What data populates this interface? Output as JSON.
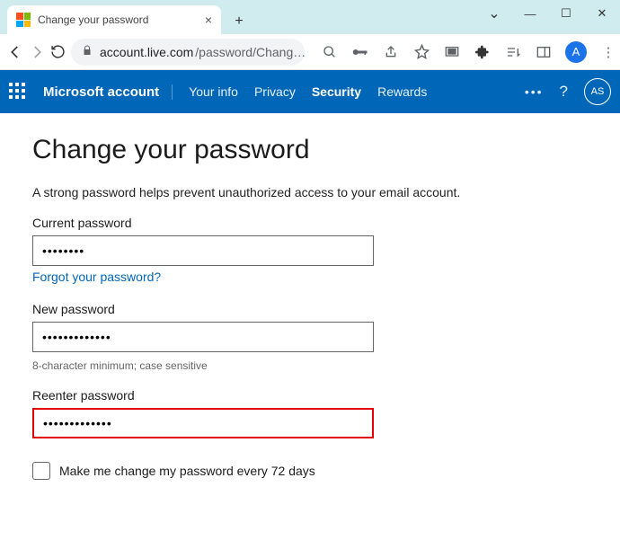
{
  "browser": {
    "tab_title": "Change your password",
    "url_display_host": "account.live.com",
    "url_display_path": "/password/Chang…",
    "profile_initial": "A"
  },
  "nav": {
    "brand": "Microsoft account",
    "items": [
      {
        "label": "Your info",
        "active": false
      },
      {
        "label": "Privacy",
        "active": false
      },
      {
        "label": "Security",
        "active": true
      },
      {
        "label": "Rewards",
        "active": false
      }
    ],
    "avatar_initials": "AS"
  },
  "page": {
    "heading": "Change your password",
    "description": "A strong password helps prevent unauthorized access to your email account.",
    "current_password_label": "Current password",
    "current_password_value": "••••••••",
    "forgot_link": "Forgot your password?",
    "new_password_label": "New password",
    "new_password_value": "•••••••••••••",
    "new_password_hint": "8-character minimum; case sensitive",
    "reenter_password_label": "Reenter password",
    "reenter_password_value": "•••••••••••••",
    "make_change_label": "Make me change my password every 72 days",
    "make_change_checked": false
  }
}
